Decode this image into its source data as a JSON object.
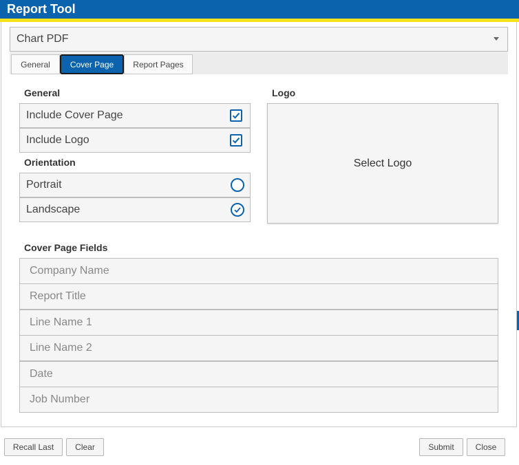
{
  "window": {
    "title": "Report Tool"
  },
  "report_type": {
    "selected": "Chart PDF"
  },
  "tabs": [
    {
      "label": "General",
      "active": false
    },
    {
      "label": "Cover Page",
      "active": true
    },
    {
      "label": "Report Pages",
      "active": false
    }
  ],
  "general": {
    "heading": "General",
    "items": [
      {
        "label": "Include Cover Page",
        "checked": true
      },
      {
        "label": "Include Logo",
        "checked": true
      }
    ]
  },
  "orientation": {
    "heading": "Orientation",
    "options": [
      {
        "label": "Portrait",
        "selected": false
      },
      {
        "label": "Landscape",
        "selected": true
      }
    ]
  },
  "logo": {
    "heading": "Logo",
    "select_label": "Select Logo"
  },
  "cover_fields": {
    "heading": "Cover Page Fields",
    "fields": [
      {
        "placeholder": "Company Name",
        "value": ""
      },
      {
        "placeholder": "Report Title",
        "value": ""
      },
      {
        "placeholder": "Line Name 1",
        "value": ""
      },
      {
        "placeholder": "Line Name 2",
        "value": ""
      },
      {
        "placeholder": "Date",
        "value": ""
      },
      {
        "placeholder": "Job Number",
        "value": ""
      }
    ]
  },
  "footer": {
    "recall_last": "Recall Last",
    "clear": "Clear",
    "submit": "Submit",
    "close": "Close"
  },
  "colors": {
    "brand_blue": "#0b63ad",
    "accent_yellow": "#f7e21c"
  }
}
